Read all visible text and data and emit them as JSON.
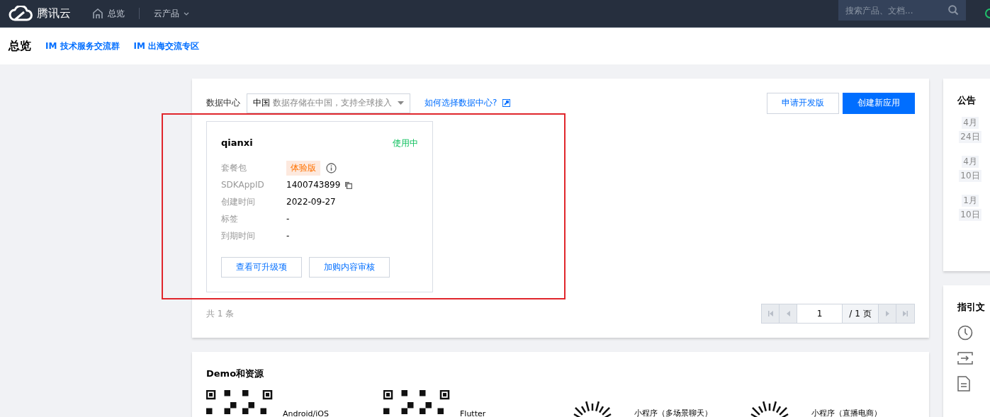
{
  "nav": {
    "logo": "腾讯云",
    "items": [
      {
        "label": "总览",
        "dropdown": false
      },
      {
        "label": "云产品",
        "dropdown": true
      }
    ],
    "search": {
      "placeholder": "搜索产品、文档..."
    }
  },
  "header": {
    "title": "总览",
    "links": [
      "IM 技术服务交流群",
      "IM 出海交流专区"
    ]
  },
  "apps": {
    "data_center": {
      "label": "数据中心",
      "value": "中国",
      "hint": "数据存储在中国，支持全球接入"
    },
    "help_link": "如何选择数据中心?",
    "buttons": [
      {
        "label": "申请开发版",
        "kind": "secondary"
      },
      {
        "label": "创建新应用",
        "kind": "primary"
      }
    ],
    "cards": [
      {
        "name": "qianxi",
        "status": "使用中",
        "fields": [
          {
            "label": "套餐包",
            "value": "体验版",
            "kind": "tag"
          },
          {
            "label": "SDKAppID",
            "value": "1400743899",
            "kind": "copy"
          },
          {
            "label": "创建时间",
            "value": "2022-09-27",
            "kind": "text"
          },
          {
            "label": "标签",
            "value": "-",
            "kind": "text"
          },
          {
            "label": "到期时间",
            "value": "-",
            "kind": "text"
          }
        ],
        "actions": [
          "查看可升级项",
          "加购内容审核"
        ]
      }
    ],
    "total": "共 1 条",
    "pagination": {
      "page": "1",
      "total_pages": "/ 1 页"
    }
  },
  "demos": {
    "title": "Demo和资源",
    "items": [
      {
        "label": "Android/iOS",
        "kind": "qr"
      },
      {
        "label": "Flutter",
        "kind": "qr"
      },
      {
        "label": "小程序（多场景聊天）",
        "kind": "sun"
      },
      {
        "label": "小程序（直播电商）",
        "kind": "sun"
      }
    ]
  },
  "notices": {
    "title": "公告",
    "items": [
      {
        "month": "4月",
        "day": "24日"
      },
      {
        "month": "4月",
        "day": "10日"
      },
      {
        "month": "1月",
        "day": "10日"
      }
    ]
  },
  "guides": {
    "title": "指引文"
  }
}
